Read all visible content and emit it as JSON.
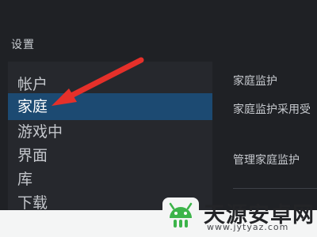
{
  "window": {
    "title": "设置"
  },
  "sidebar": {
    "items": [
      {
        "label": "帐户"
      },
      {
        "label": "家庭",
        "active": true
      },
      {
        "label": "游戏中"
      },
      {
        "label": "界面"
      },
      {
        "label": "库"
      },
      {
        "label": "下载"
      }
    ]
  },
  "content": {
    "heading": "家庭监护",
    "description": "家庭监护采用受",
    "manage_label": "管理家庭监护"
  },
  "annotation": {
    "color": "#e5302a",
    "target": "家庭"
  },
  "watermark": {
    "title": "天源安卓网",
    "url": "www.jytyaz.com",
    "logo_color": "#3cb44a"
  },
  "colors": {
    "accent": "#1c4a72",
    "window_bg": "#1f2125",
    "sidebar_bg": "#26282d"
  }
}
